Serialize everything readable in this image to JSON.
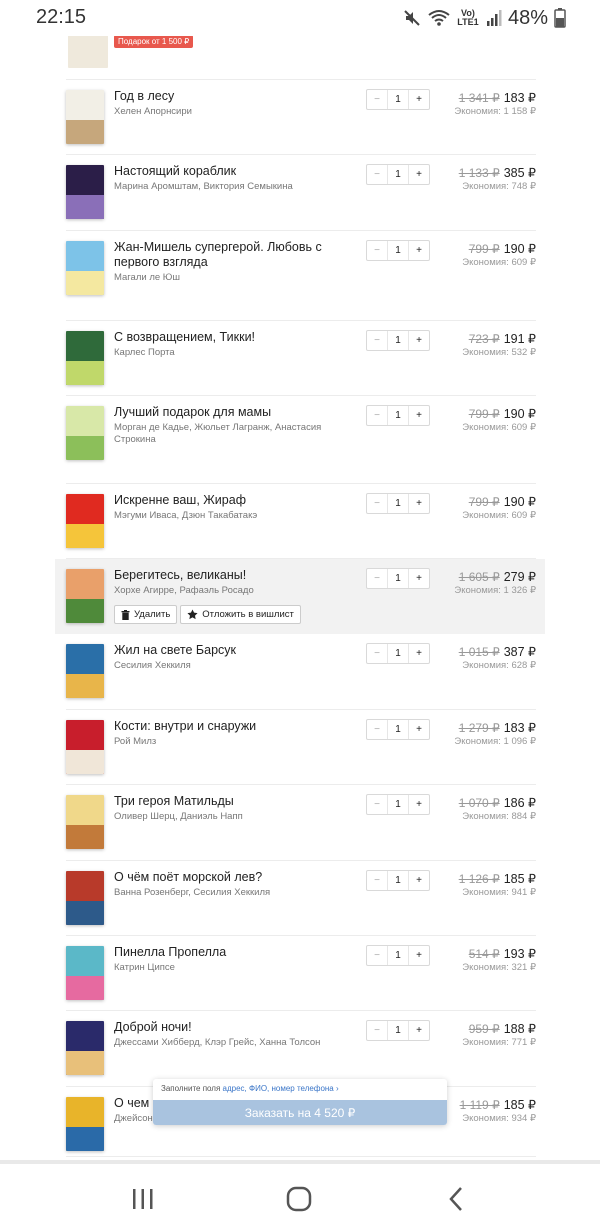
{
  "status_bar": {
    "time": "22:15",
    "network": "Vo) LTE1",
    "battery": "48%",
    "icons": [
      "mute-icon",
      "wifi-icon",
      "signal-icon",
      "battery-icon"
    ]
  },
  "gift": {
    "badge": "Подарок от 1 500 ₽"
  },
  "stepper": {
    "minus": "−",
    "plus": "+"
  },
  "items": [
    {
      "title": "Год в лесу",
      "author": "Хелен Апорнсири",
      "qty": "1",
      "old_price": "1 341 ₽",
      "price": "183 ₽",
      "economy": "Экономия: 1 158 ₽",
      "cover": [
        "#f2efe6",
        "#c6a77c"
      ]
    },
    {
      "title": "Настоящий кораблик",
      "author": "Марина Аромштам, Виктория Семыкина",
      "qty": "1",
      "old_price": "1 133 ₽",
      "price": "385 ₽",
      "economy": "Экономия: 748 ₽",
      "cover": [
        "#2b1e48",
        "#8a6fb8"
      ]
    },
    {
      "title": "Жан-Мишель супергерой. Любовь с первого взгляда",
      "author": "Магали ле Юш",
      "qty": "1",
      "old_price": "799 ₽",
      "price": "190 ₽",
      "economy": "Экономия: 609 ₽",
      "cover": [
        "#7dc3e8",
        "#f4e8a0"
      ]
    },
    {
      "title": "С возвращением, Тикки!",
      "author": "Карлес Порта",
      "qty": "1",
      "old_price": "723 ₽",
      "price": "191 ₽",
      "economy": "Экономия: 532 ₽",
      "cover": [
        "#2f6a3a",
        "#c0d86a"
      ]
    },
    {
      "title": "Лучший подарок для мамы",
      "author": "Морган де Кадье, Жюльет Лагранж, Анастасия Строкина",
      "qty": "1",
      "old_price": "799 ₽",
      "price": "190 ₽",
      "economy": "Экономия: 609 ₽",
      "cover": [
        "#d8e8a8",
        "#8cbf5a"
      ]
    },
    {
      "title": "Искренне ваш, Жираф",
      "author": "Мэгуми Иваса, Дзюн Такабатакэ",
      "qty": "1",
      "old_price": "799 ₽",
      "price": "190 ₽",
      "economy": "Экономия: 609 ₽",
      "cover": [
        "#e02a20",
        "#f5c53a"
      ]
    },
    {
      "title": "Берегитесь, великаны!",
      "author": "Хорхе Агирре, Рафаэль Росадо",
      "qty": "1",
      "old_price": "1 605 ₽",
      "price": "279 ₽",
      "economy": "Экономия: 1 326 ₽",
      "cover": [
        "#e9a06a",
        "#4f8a3a"
      ]
    },
    {
      "title": "Жил на свете Барсук",
      "author": "Сесилия Хеккиля",
      "qty": "1",
      "old_price": "1 015 ₽",
      "price": "387 ₽",
      "economy": "Экономия: 628 ₽",
      "cover": [
        "#2a6fa8",
        "#e8b54a"
      ]
    },
    {
      "title": "Кости: внутри и снаружи",
      "author": "Рой Милз",
      "qty": "1",
      "old_price": "1 279 ₽",
      "price": "183 ₽",
      "economy": "Экономия: 1 096 ₽",
      "cover": [
        "#c81e2c",
        "#f0e6d8"
      ]
    },
    {
      "title": "Три героя Матильды",
      "author": "Оливер Шерц, Даниэль Напп",
      "qty": "1",
      "old_price": "1 070 ₽",
      "price": "186 ₽",
      "economy": "Экономия: 884 ₽",
      "cover": [
        "#f0d88a",
        "#c27a3a"
      ]
    },
    {
      "title": "О чём поёт морской лев?",
      "author": "Ванна Розенберг, Сесилия Хеккиля",
      "qty": "1",
      "old_price": "1 126 ₽",
      "price": "185 ₽",
      "economy": "Экономия: 941 ₽",
      "cover": [
        "#b83a2a",
        "#2d5a8a"
      ]
    },
    {
      "title": "Пинелла Пропелла",
      "author": "Катрин Ципсе",
      "qty": "1",
      "old_price": "514 ₽",
      "price": "193 ₽",
      "economy": "Экономия: 321 ₽",
      "cover": [
        "#5bb8c8",
        "#e66aa0"
      ]
    },
    {
      "title": "Доброй ночи!",
      "author": "Джессами Хибберд, Клэр Грейс, Ханна Толсон",
      "qty": "1",
      "old_price": "959 ₽",
      "price": "188 ₽",
      "economy": "Экономия: 771 ₽",
      "cover": [
        "#2a2a6a",
        "#e8c07a"
      ]
    },
    {
      "title": "О чем р",
      "author": "Джейсон",
      "qty": "1",
      "old_price": "1 119 ₽",
      "price": "185 ₽",
      "economy": "Экономия: 934 ₽",
      "cover": [
        "#e8b42a",
        "#2a6aa8"
      ]
    }
  ],
  "item_actions": {
    "delete": "Удалить",
    "wishlist": "Отложить в вишлист"
  },
  "order": {
    "hint_prefix": "Заполните поля",
    "hint_fields": "адрес, ФИО, номер телефона ›",
    "button": "Заказать на 4 520 ₽"
  },
  "nav": {
    "icons": [
      "recent-apps-icon",
      "home-icon",
      "back-icon"
    ]
  }
}
